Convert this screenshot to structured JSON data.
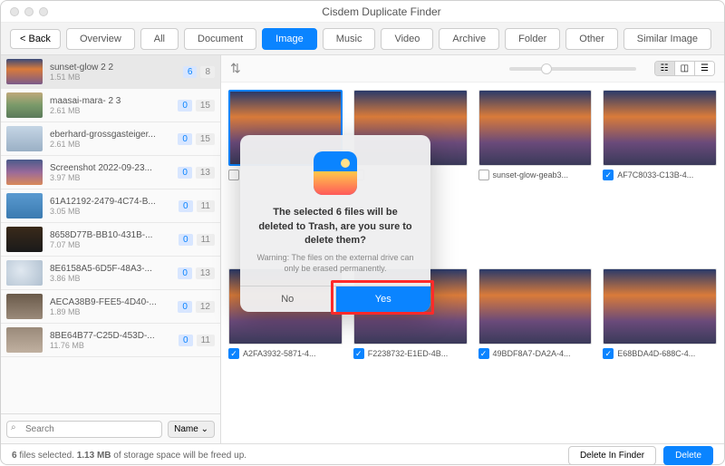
{
  "window": {
    "title": "Cisdem Duplicate Finder"
  },
  "toolbar": {
    "back": "< Back",
    "tabs": [
      "Overview",
      "All",
      "Document",
      "Image",
      "Music",
      "Video",
      "Archive",
      "Folder",
      "Other",
      "Similar Image"
    ],
    "active_index": 3
  },
  "files": [
    {
      "name": "sunset-glow 2 2",
      "size": "1.51 MB",
      "sel": "6",
      "tot": "8",
      "thumb": "t1",
      "selected": true
    },
    {
      "name": "maasai-mara- 2 3",
      "size": "2.61 MB",
      "sel": "0",
      "tot": "15",
      "thumb": "t2"
    },
    {
      "name": "eberhard-grossgasteiger...",
      "size": "2.61 MB",
      "sel": "0",
      "tot": "15",
      "thumb": "t3"
    },
    {
      "name": "Screenshot 2022-09-23...",
      "size": "3.97 MB",
      "sel": "0",
      "tot": "13",
      "thumb": "t4"
    },
    {
      "name": "61A12192-2479-4C74-B...",
      "size": "3.05 MB",
      "sel": "0",
      "tot": "11",
      "thumb": "t5"
    },
    {
      "name": "8658D77B-BB10-431B-...",
      "size": "7.07 MB",
      "sel": "0",
      "tot": "11",
      "thumb": "t6"
    },
    {
      "name": "8E6158A5-6D5F-48A3-...",
      "size": "3.86 MB",
      "sel": "0",
      "tot": "13",
      "thumb": "t7"
    },
    {
      "name": "AECA38B9-FEE5-4D40-...",
      "size": "1.89 MB",
      "sel": "0",
      "tot": "12",
      "thumb": "t8"
    },
    {
      "name": "8BE64B77-C25D-453D-...",
      "size": "11.76 MB",
      "sel": "0",
      "tot": "11",
      "thumb": "t9"
    }
  ],
  "search": {
    "placeholder": "Search"
  },
  "sort": {
    "label": "Name"
  },
  "grid": {
    "row1": [
      {
        "label": "",
        "checked": false
      },
      {
        "label": "",
        "checked": false
      },
      {
        "label": "sunset-glow-geab3...",
        "checked": false
      },
      {
        "label": "AF7C8033-C13B-4...",
        "checked": true
      }
    ],
    "row2": [
      {
        "label": "A2FA3932-5871-4...",
        "checked": true
      },
      {
        "label": "F2238732-E1ED-4B...",
        "checked": true
      },
      {
        "label": "49BDF8A7-DA2A-4...",
        "checked": true
      },
      {
        "label": "E68BDA4D-688C-4...",
        "checked": true
      }
    ]
  },
  "modal": {
    "title": "The selected 6 files will be deleted to Trash, are you sure to delete them?",
    "warning": "Warning: The files on the external drive can only be erased permanently.",
    "no": "No",
    "yes": "Yes"
  },
  "status": {
    "text_a": "6",
    "text_b": " files selected. ",
    "text_c": "1.13 MB",
    "text_d": " of storage space will be freed up.",
    "delete_finder": "Delete In Finder",
    "delete": "Delete"
  },
  "view_icons": [
    "☷",
    "◫",
    "☰"
  ]
}
